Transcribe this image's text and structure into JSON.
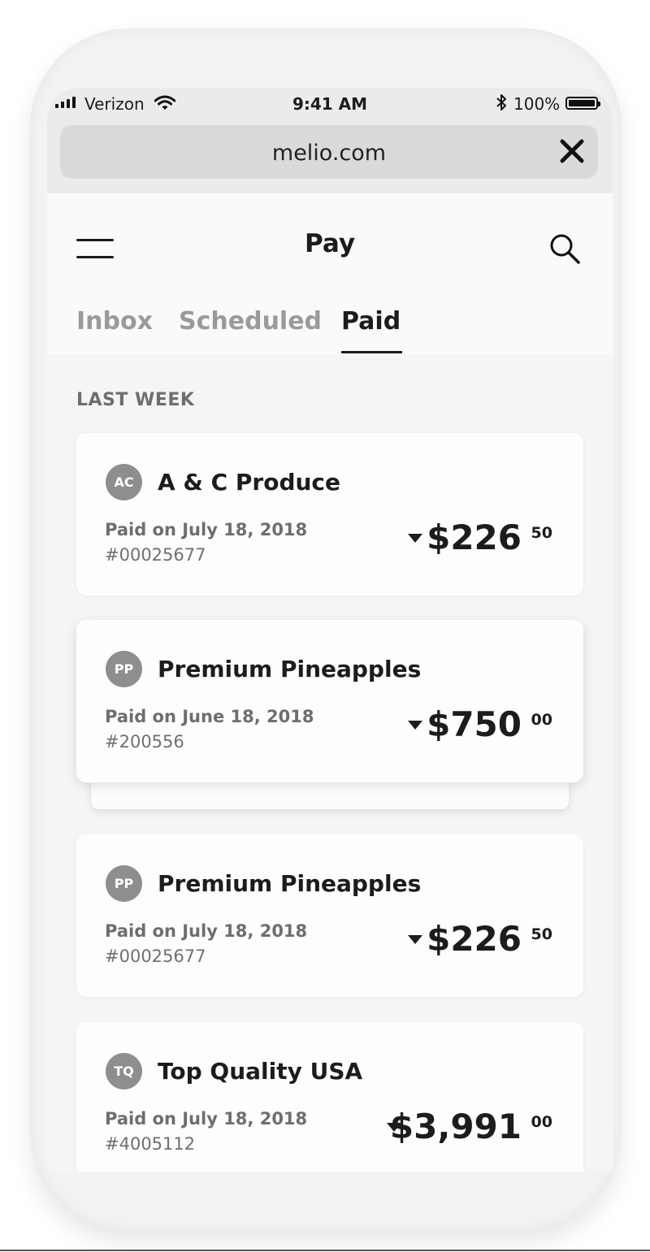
{
  "status_bar": {
    "carrier": "Verizon",
    "time": "9:41 AM",
    "battery": "100%"
  },
  "browser": {
    "url": "melio.com"
  },
  "header": {
    "title": "Pay",
    "tabs": [
      {
        "label": "Inbox",
        "active": false
      },
      {
        "label": "Scheduled",
        "active": false
      },
      {
        "label": "Paid",
        "active": true
      }
    ]
  },
  "section": {
    "title": "LAST WEEK"
  },
  "payments": [
    {
      "initials": "AC",
      "vendor": "A & C Produce",
      "paid_on": "Paid on July 18, 2018",
      "invoice": "#00025677",
      "amount": "$226",
      "cents": "50"
    },
    {
      "initials": "PP",
      "vendor": "Premium Pineapples",
      "paid_on": "Paid on June 18, 2018",
      "invoice": "#200556",
      "amount": "$750",
      "cents": "00"
    },
    {
      "initials": "PP",
      "vendor": "Premium Pineapples",
      "paid_on": "Paid on July 18, 2018",
      "invoice": "#00025677",
      "amount": "$226",
      "cents": "50"
    },
    {
      "initials": "TQ",
      "vendor": "Top Quality USA",
      "paid_on": "Paid on July 18, 2018",
      "invoice": "#4005112",
      "amount": "$3,991",
      "cents": "00"
    }
  ],
  "icons": {
    "signal": "signal-bars-icon",
    "wifi": "wifi-icon",
    "bluetooth": "bluetooth-icon",
    "battery": "battery-icon",
    "close": "close-icon",
    "menu": "hamburger-menu-icon",
    "search": "search-icon",
    "expand": "caret-down-icon"
  }
}
